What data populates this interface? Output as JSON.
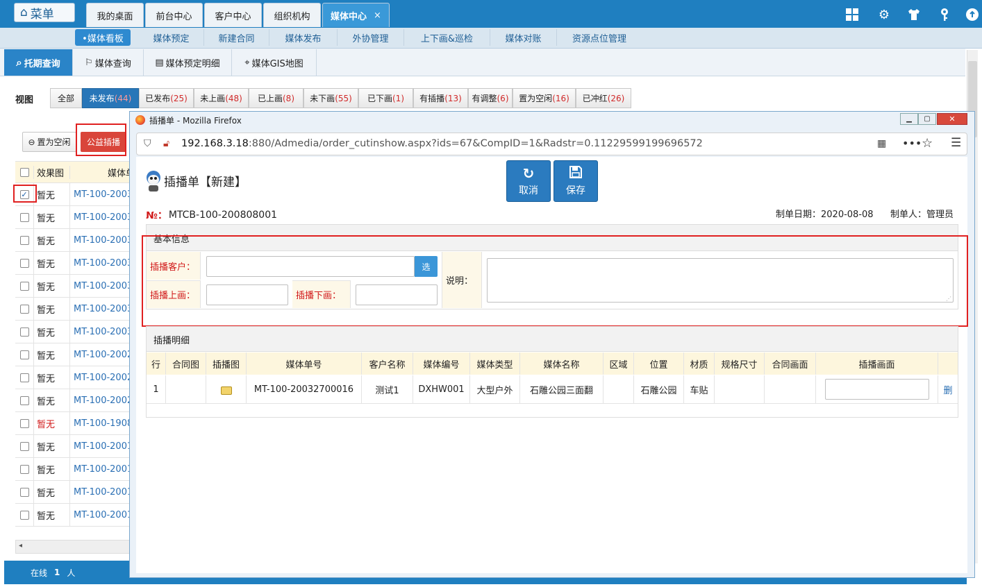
{
  "app": {
    "menu_label": "菜单"
  },
  "top_tabs": [
    {
      "label": "我的桌面"
    },
    {
      "label": "前台中心"
    },
    {
      "label": "客户中心"
    },
    {
      "label": "组织机构"
    },
    {
      "label": "媒体中心",
      "active": true,
      "close": "×"
    }
  ],
  "top_icons": [
    "grid-icon",
    "gear-icon",
    "shirt-icon",
    "key-icon",
    "power-icon"
  ],
  "menubar": [
    "•媒体看板",
    "媒体预定",
    "新建合同",
    "媒体发布",
    "外协管理",
    "上下画&巡检",
    "媒体对账",
    "资源点位管理"
  ],
  "subtabs": [
    "托期查询",
    "媒体查询",
    "媒体预定明细",
    "媒体GIS地图"
  ],
  "view_label": "视图",
  "filters": [
    {
      "label": "全部",
      "count": ""
    },
    {
      "label": "未发布",
      "count": "(44)"
    },
    {
      "label": "已发布",
      "count": "(25)"
    },
    {
      "label": "未上画",
      "count": "(48)"
    },
    {
      "label": "已上画",
      "count": "(8)"
    },
    {
      "label": "未下画",
      "count": "(55)"
    },
    {
      "label": "已下画",
      "count": "(1)"
    },
    {
      "label": "有插播",
      "count": "(13)"
    },
    {
      "label": "有调整",
      "count": "(6)"
    },
    {
      "label": "置为空闲",
      "count": "(16)"
    },
    {
      "label": "已冲红",
      "count": "(26)"
    }
  ],
  "actions": {
    "set_idle": "置为空闲",
    "public_cutin": "公益插播"
  },
  "left_table": {
    "headers": [
      "效果图",
      "媒体单"
    ],
    "rows": [
      {
        "effect": "暂无",
        "code": "MT-100-2003",
        "checked": true
      },
      {
        "effect": "暂无",
        "code": "MT-100-2003"
      },
      {
        "effect": "暂无",
        "code": "MT-100-2003"
      },
      {
        "effect": "暂无",
        "code": "MT-100-2003"
      },
      {
        "effect": "暂无",
        "code": "MT-100-2003"
      },
      {
        "effect": "暂无",
        "code": "MT-100-2003"
      },
      {
        "effect": "暂无",
        "code": "MT-100-2003"
      },
      {
        "effect": "暂无",
        "code": "MT-100-2002"
      },
      {
        "effect": "暂无",
        "code": "MT-100-2002"
      },
      {
        "effect": "暂无",
        "code": "MT-100-2002"
      },
      {
        "effect": "暂无",
        "code": "MT-100-1908",
        "red": true
      },
      {
        "effect": "暂无",
        "code": "MT-100-2001"
      },
      {
        "effect": "暂无",
        "code": "MT-100-2001"
      },
      {
        "effect": "暂无",
        "code": "MT-100-2001"
      },
      {
        "effect": "暂无",
        "code": "MT-100-2001"
      }
    ]
  },
  "status": {
    "online_label": "在线",
    "online_count": "1",
    "unit": "人"
  },
  "dialog": {
    "title": "插播单 - Mozilla Firefox",
    "url_host": "192.168.3.18",
    "url_rest": ":880/Admedia/order_cutinshow.aspx?ids=67&CompID=1&Radstr=0.11229599199696572",
    "heading": "插播单【新建】",
    "cancel": "取消",
    "save": "保存",
    "no_label": "№：",
    "no_value": "MTCB-100-200808001",
    "date_label": "制单日期：2020-08-08",
    "maker_label": "制单人：管理员",
    "basic_section": "基本信息",
    "customer_label": "插播客户：",
    "select_btn": "选",
    "desc_label": "说明：",
    "up_label": "插播上画：",
    "down_label": "插播下画：",
    "detail_section": "插播明细",
    "detail_headers": [
      "行",
      "合同图",
      "插播图",
      "媒体单号",
      "客户名称",
      "媒体编号",
      "媒体类型",
      "媒体名称",
      "区域",
      "位置",
      "材质",
      "规格尺寸",
      "合同画面",
      "插播画面"
    ],
    "detail_row": {
      "row": "1",
      "order_no": "MT-100-20032700016",
      "customer": "测试1",
      "media_no": "DXHW001",
      "media_type": "大型户外",
      "media_name": "石雕公园三面翻",
      "area": "",
      "position": "石雕公园",
      "material": "车贴",
      "size": "",
      "contract_pic": "",
      "delete": "删"
    }
  }
}
